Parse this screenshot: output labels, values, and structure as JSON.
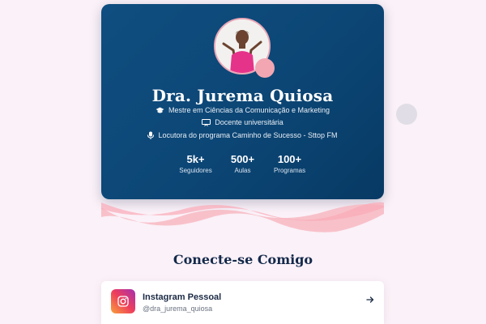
{
  "profile": {
    "name": "Dra. Jurema Quiosa",
    "lines": [
      {
        "icon": "graduation-cap-icon",
        "text": "Mestre em Ciências da Comunicação e Marketing"
      },
      {
        "icon": "presentation-icon",
        "text": "Docente universitária"
      },
      {
        "icon": "microphone-icon",
        "text": "Locutora do programa Caminho de Sucesso - Sttop FM"
      }
    ],
    "stats": [
      {
        "value": "5k+",
        "label": "Seguidores"
      },
      {
        "value": "500+",
        "label": "Aulas"
      },
      {
        "value": "100+",
        "label": "Programas"
      }
    ]
  },
  "connect": {
    "heading": "Conecte-se Comigo",
    "links": [
      {
        "icon": "instagram-icon",
        "title": "Instagram Pessoal",
        "handle": "@dra_jurema_quiosa"
      }
    ]
  },
  "colors": {
    "card_bg": "#0c4675",
    "accent_pink": "#f2a6b2",
    "page_bg": "#fbf1f8"
  }
}
